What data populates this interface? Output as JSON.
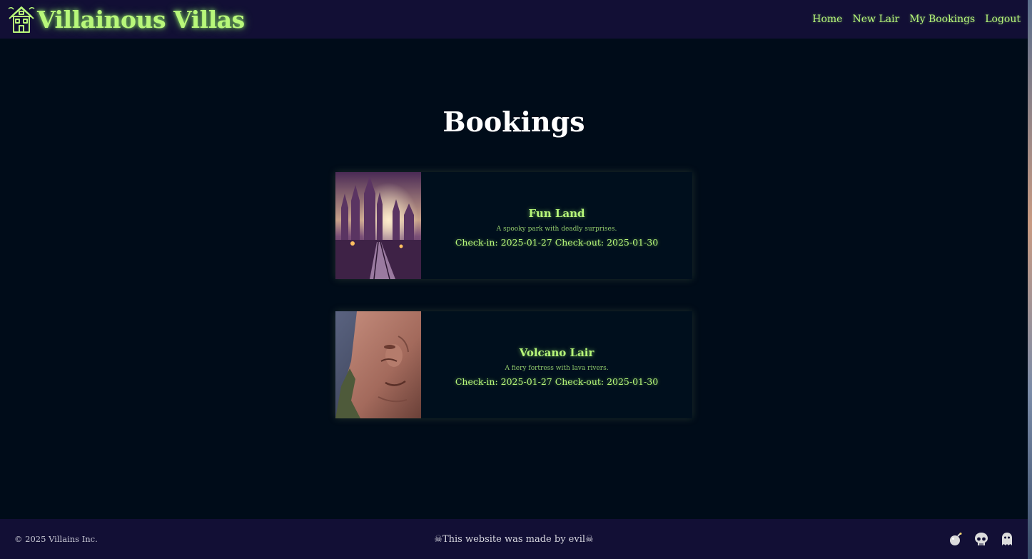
{
  "header": {
    "brand_name": "Villainous Villas",
    "brand_icon": "haunted-house-icon",
    "nav": {
      "home": "Home",
      "new_lair": "New Lair",
      "my_bookings": "My Bookings",
      "logout": "Logout"
    }
  },
  "main": {
    "title": "Bookings",
    "bookings": [
      {
        "name": "Fun Land",
        "description": "A spooky park with deadly surprises.",
        "dates": "Check-in: 2025-01-27 Check-out: 2025-01-30",
        "image": "haunted-castle-path-image"
      },
      {
        "name": "Volcano Lair",
        "description": "A fiery fortress with lava rivers.",
        "dates": "Check-in: 2025-01-27 Check-out: 2025-01-30",
        "image": "stone-face-cliff-image"
      }
    ]
  },
  "footer": {
    "copyright": "© 2025 Villains Inc.",
    "credit": "☠This website was made by evil☠",
    "social_icons": [
      "bomb-icon",
      "skull-icon",
      "ghost-icon"
    ]
  },
  "colors": {
    "accent": "#b8f77a",
    "header_bg": "#120f35",
    "page_bg": "#000c19",
    "card_bg": "#000f1d"
  }
}
